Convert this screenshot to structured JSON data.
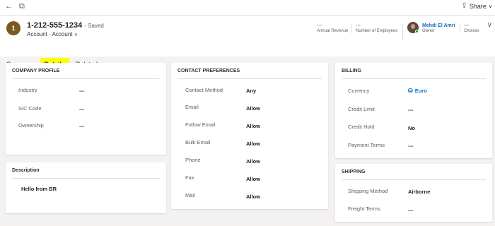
{
  "topbar": {
    "back_icon": "←",
    "popout_icon": "⧉",
    "share_label": "Share",
    "share_chevron": "∨"
  },
  "record": {
    "initial": "1",
    "title": "1-212-555-1234",
    "saved": "- Saved",
    "entity": "Account",
    "form": "Account",
    "form_chevron": "∨"
  },
  "header_fields": [
    {
      "value": "---",
      "label": "Annual Revenue"
    },
    {
      "value": "---",
      "label": "Number of Employees"
    },
    {
      "value": "Mehdi El Amri",
      "label": "Owner"
    },
    {
      "value": "---",
      "label": "Choices"
    }
  ],
  "header_chevron": "∨",
  "tabs": [
    {
      "label": "Summary"
    },
    {
      "label": "Details"
    },
    {
      "label": "Related",
      "chevron": "∨"
    }
  ],
  "company_profile": {
    "title": "COMPANY PROFILE",
    "fields": [
      {
        "label": "Industry",
        "value": "---"
      },
      {
        "label": "SIC Code",
        "value": "---"
      },
      {
        "label": "Ownership",
        "value": "---"
      }
    ]
  },
  "description": {
    "title": "Description",
    "value": "Hello from BR"
  },
  "contact_preferences": {
    "title": "CONTACT PREFERENCES",
    "fields": [
      {
        "label": "Contact Method",
        "value": "Any"
      },
      {
        "label": "Email",
        "value": "Allow"
      },
      {
        "label": "Follow Email",
        "value": "Allow"
      },
      {
        "label": "Bulk Email",
        "value": "Allow"
      },
      {
        "label": "Phone",
        "value": "Allow"
      },
      {
        "label": "Fax",
        "value": "Allow"
      },
      {
        "label": "Mail",
        "value": "Allow"
      }
    ]
  },
  "billing": {
    "title": "BILLING",
    "fields": [
      {
        "label": "Currency",
        "value": "Euro",
        "icon": "coins-icon"
      },
      {
        "label": "Credit Limit",
        "value": "---"
      },
      {
        "label": "Credit Hold",
        "value": "No"
      },
      {
        "label": "Payment Terms",
        "value": "---"
      }
    ]
  },
  "shipping": {
    "title": "SHIPPING",
    "fields": [
      {
        "label": "Shipping Method",
        "value": "Airborne"
      },
      {
        "label": "Freight Terms",
        "value": "---"
      }
    ]
  },
  "colors": {
    "accent": "#0f6cbd",
    "highlight": "#ffff00",
    "avatar": "#7a5a1e",
    "background": "#f3f2f1"
  }
}
